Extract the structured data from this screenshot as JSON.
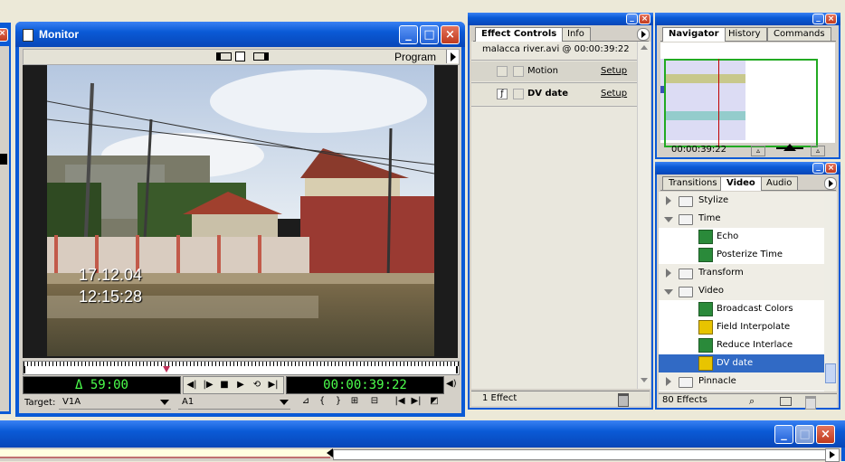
{
  "colors": {
    "title_bar": "#0a5ad6",
    "timecode_text": "#4cff4c",
    "timecode_bg": "#000000",
    "selected_row": "#316ac5",
    "panel_bg": "#d4d0c8"
  },
  "monitor": {
    "title": "Monitor",
    "view_label": "Program",
    "video_date": "17.12.04",
    "video_time": "12:15:28",
    "duration": "Δ 59:00",
    "timecode": "00:00:39:22",
    "target_label": "Target:",
    "target_video": "V1A",
    "target_audio": "A1",
    "icons": {
      "title": "monitor-window-icon",
      "views": [
        "dual-view-icon",
        "single-view-icon",
        "trim-view-icon"
      ],
      "transport": [
        "step-back-icon",
        "step-forward-icon",
        "stop-icon",
        "play-icon",
        "loop-icon",
        "play-to-out-icon"
      ]
    }
  },
  "effect_controls": {
    "tabs": [
      "Effect Controls",
      "Info"
    ],
    "clip_info": "malacca river.avi @ 00:00:39:22",
    "effects": [
      {
        "name": "Motion",
        "setup": "Setup",
        "enabled": false
      },
      {
        "name": "DV date",
        "setup": "Setup",
        "enabled": true
      }
    ],
    "count": "1 Effect"
  },
  "navigator": {
    "tabs": [
      "Navigator",
      "History",
      "Commands"
    ],
    "timecode": "00:00:39:22"
  },
  "effects_palette": {
    "tabs": [
      "Transitions",
      "Video",
      "Audio"
    ],
    "items": [
      {
        "label": "Stylize",
        "kind": "folder",
        "expanded": false
      },
      {
        "label": "Time",
        "kind": "folder",
        "expanded": true
      },
      {
        "label": "Echo",
        "kind": "effect"
      },
      {
        "label": "Posterize Time",
        "kind": "effect"
      },
      {
        "label": "Transform",
        "kind": "folder",
        "expanded": false
      },
      {
        "label": "Video",
        "kind": "folder",
        "expanded": true
      },
      {
        "label": "Broadcast Colors",
        "kind": "effect"
      },
      {
        "label": "Field Interpolate",
        "kind": "effect-v"
      },
      {
        "label": "Reduce Interlace Flicker",
        "kind": "effect"
      },
      {
        "label": "DV date",
        "kind": "effect-v",
        "selected": true
      },
      {
        "label": "Pinnacle",
        "kind": "folder",
        "expanded": false
      }
    ],
    "count": "80 Effects"
  }
}
